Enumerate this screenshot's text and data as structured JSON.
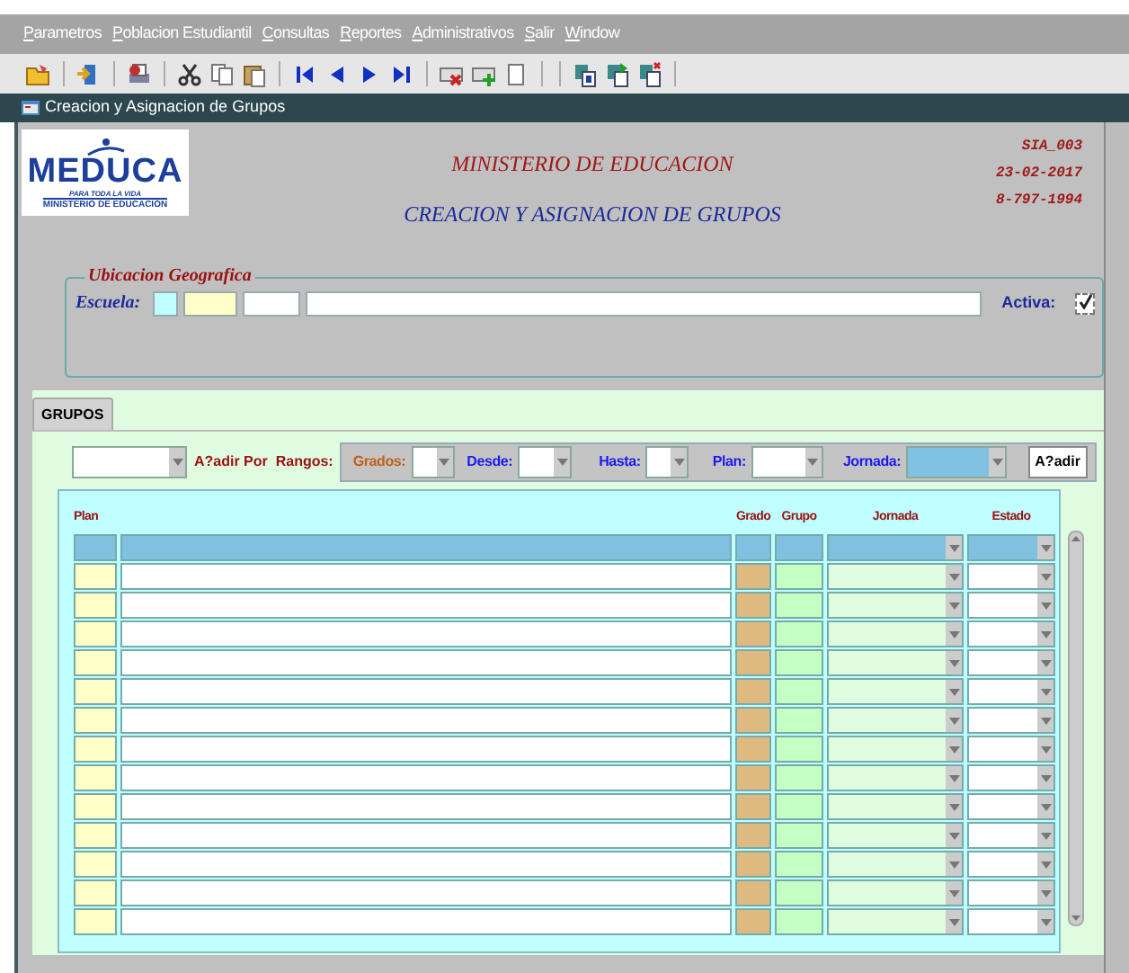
{
  "menu": [
    "Parametros",
    "Poblacion Estudiantil",
    "Consultas",
    "Reportes",
    "Administrativos",
    "Salir",
    "Window"
  ],
  "window": {
    "title": "Creacion y Asignacion de Grupos"
  },
  "logo": {
    "name": "MEDUCA",
    "slogan": "PARA TODA LA VIDA",
    "subtitle": "MINISTERIO DE EDUCACIÓN"
  },
  "header": {
    "title": "MINISTERIO DE EDUCACION",
    "subtitle": "CREACION Y ASIGNACION DE GRUPOS",
    "code": "SIA_003",
    "date": "23-02-2017",
    "user": "8-797-1994"
  },
  "ubicacion": {
    "legend": "Ubicacion Geografica",
    "escuela_label": "Escuela:",
    "activa": {
      "label": "Activa:",
      "checked": true
    }
  },
  "tabs": [
    {
      "label": "GRUPOS",
      "selected": true
    }
  ],
  "filters": {
    "rangos_label": "A?adir Por  Rangos:",
    "fields": [
      {
        "label": "Grados:",
        "color": "#c0601a",
        "highlighted": false
      },
      {
        "label": "Desde:",
        "color": "#1a1aee",
        "highlighted": false
      },
      {
        "label": "Hasta:",
        "color": "#1a1aee",
        "highlighted": false
      },
      {
        "label": "Plan:",
        "color": "#1a1aee",
        "highlighted": false
      },
      {
        "label": "Jornada:",
        "color": "#1a1aee",
        "highlighted": true
      }
    ],
    "button": "A?adir"
  },
  "grid": {
    "columns": [
      "Plan",
      "Grado",
      "Grupo",
      "Jornada",
      "Estado"
    ]
  }
}
